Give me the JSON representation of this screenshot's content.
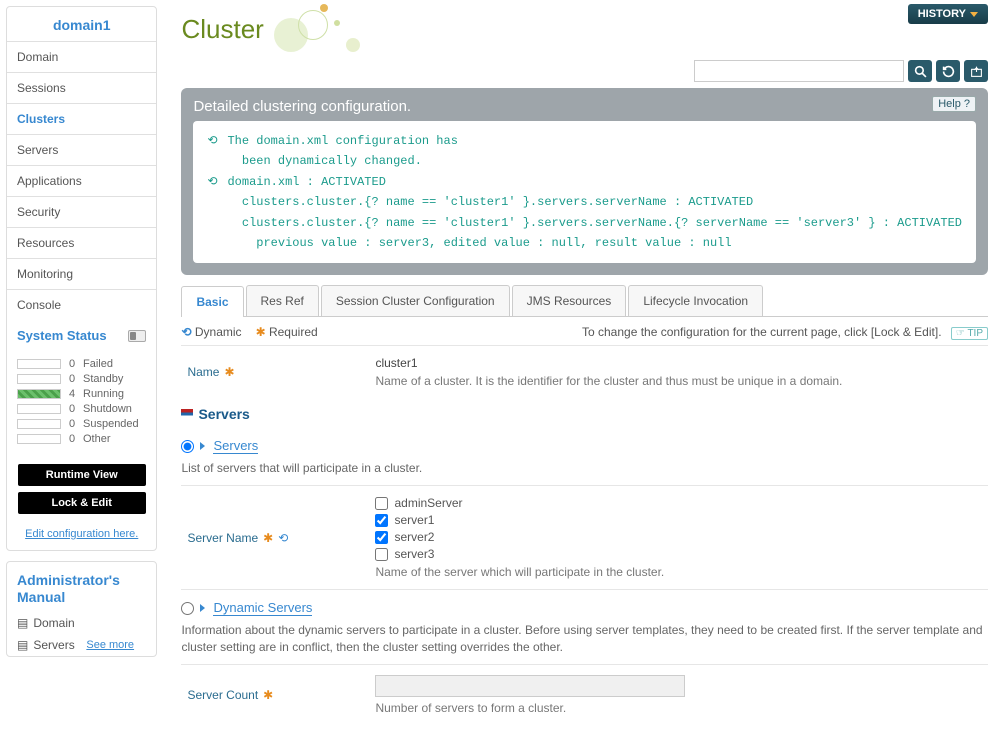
{
  "sidebar": {
    "domain": "domain1",
    "nav": [
      {
        "label": "Domain"
      },
      {
        "label": "Sessions"
      },
      {
        "label": "Clusters",
        "active": true
      },
      {
        "label": "Servers"
      },
      {
        "label": "Applications"
      },
      {
        "label": "Security"
      },
      {
        "label": "Resources"
      },
      {
        "label": "Monitoring"
      },
      {
        "label": "Console"
      }
    ],
    "system_status_title": "System Status",
    "statuses": [
      {
        "count": 0,
        "label": "Failed",
        "filled": false
      },
      {
        "count": 0,
        "label": "Standby",
        "filled": false
      },
      {
        "count": 4,
        "label": "Running",
        "filled": true
      },
      {
        "count": 0,
        "label": "Shutdown",
        "filled": false
      },
      {
        "count": 0,
        "label": "Suspended",
        "filled": false
      },
      {
        "count": 0,
        "label": "Other",
        "filled": false
      }
    ],
    "runtime_btn": "Runtime View",
    "lock_btn": "Lock & Edit",
    "edit_link": "Edit configuration here.",
    "admin_title": "Administrator's Manual",
    "admin_items": [
      "Domain",
      "Servers"
    ],
    "see_more": "See more"
  },
  "main": {
    "title": "Cluster",
    "history": "HISTORY",
    "panel_title": "Detailed clustering configuration.",
    "help": "Help",
    "cfg_lines": [
      "The domain.xml configuration has",
      "  been dynamically changed.",
      "domain.xml : ACTIVATED",
      "  clusters.cluster.{? name == 'cluster1' }.servers.serverName : ACTIVATED",
      "  clusters.cluster.{? name == 'cluster1' }.servers.serverName.{? serverName == 'server3' } : ACTIVATED",
      "    previous value : server3, edited value : null, result value : null"
    ],
    "tabs": [
      "Basic",
      "Res Ref",
      "Session Cluster Configuration",
      "JMS Resources",
      "Lifecycle Invocation"
    ],
    "legend": {
      "dynamic": "Dynamic",
      "required": "Required",
      "tip_text": "To change the configuration for the current page, click [Lock & Edit].",
      "tip": "TIP"
    },
    "name_field": {
      "label": "Name",
      "value": "cluster1",
      "desc": "Name of a cluster. It is the identifier for the cluster and thus must be unique in a domain."
    },
    "servers_section": "Servers",
    "servers_radio": {
      "label": "Servers",
      "desc": "List of servers that will participate in a cluster."
    },
    "server_name_field": {
      "label": "Server Name",
      "options": [
        {
          "name": "adminServer",
          "checked": false
        },
        {
          "name": "server1",
          "checked": true
        },
        {
          "name": "server2",
          "checked": true
        },
        {
          "name": "server3",
          "checked": false
        }
      ],
      "desc": "Name of the server which will participate in the cluster."
    },
    "dynamic_servers": {
      "label": "Dynamic Servers",
      "desc": "Information about the dynamic servers to participate in a cluster. Before using server templates, they need to be created first. If the server template and cluster setting are in conflict, then the cluster setting overrides the other."
    },
    "server_count": {
      "label": "Server Count",
      "desc": "Number of servers to form a cluster."
    }
  }
}
